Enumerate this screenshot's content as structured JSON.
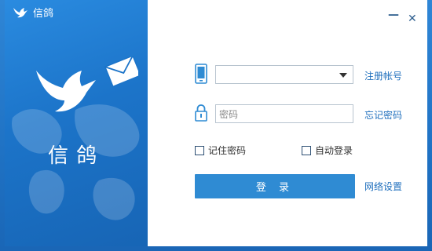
{
  "window": {
    "title": "信鸽",
    "app_name": "信鸽",
    "minimize_glyph": "—",
    "close_glyph": "✕"
  },
  "login": {
    "account_value": "",
    "password_placeholder": "密码",
    "register_link": "注册帐号",
    "forgot_link": "忘记密码",
    "remember_label": "记住密码",
    "remember_checked": false,
    "autologin_label": "自动登录",
    "autologin_checked": false,
    "login_button": "登 录",
    "network_link": "网络设置"
  },
  "colors": {
    "accent": "#2f8bd3",
    "panel": "#1c74c9",
    "link": "#1f6fbd"
  },
  "icons": [
    "dove-logo-icon",
    "dove-envelope-logo-icon",
    "phone-icon",
    "lock-icon",
    "minimize-icon",
    "close-icon"
  ]
}
